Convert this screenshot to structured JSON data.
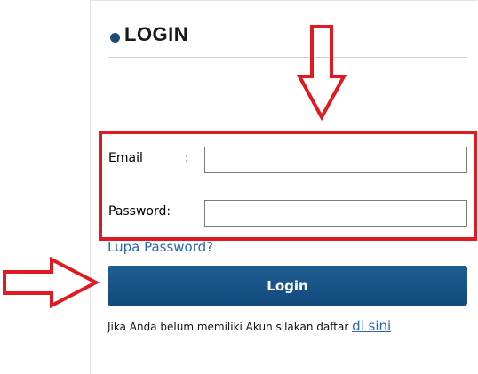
{
  "header": {
    "title": "LOGIN"
  },
  "form": {
    "email_label": "Email",
    "email_colon": ":",
    "email_value": "",
    "password_label": "Password:",
    "password_value": "",
    "forgot_link": "Lupa Password?",
    "login_button": "Login"
  },
  "footer": {
    "register_text": "Jika Anda belum memiliki Akun silakan daftar ",
    "register_link": "di sini"
  },
  "colors": {
    "accent": "#1f5d92",
    "annotation": "#e11a22",
    "link": "#2a66b5"
  },
  "icons": [
    "bullet-dot-icon",
    "down-arrow-annotation-icon",
    "right-arrow-annotation-icon"
  ]
}
